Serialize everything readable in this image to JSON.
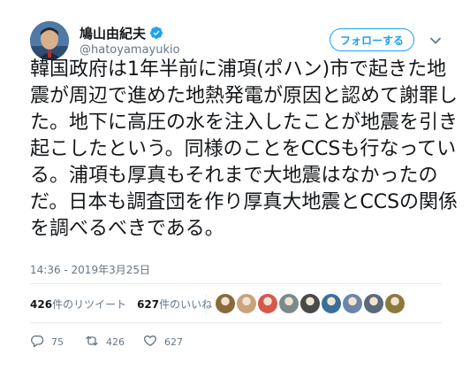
{
  "user": {
    "display_name": "鳩山由紀夫",
    "handle": "@hatoyamayukio",
    "verified": true
  },
  "follow_button": {
    "label": "フォローする"
  },
  "tweet": {
    "text": "韓国政府は1年半前に浦項(ポハン)市で起きた地震が周辺で進めた地熱発電が原因と認めて謝罪した。地下に高圧の水を注入したことが地震を引き起こしたという。同様のことをCCSも行なっている。浦項も厚真もそれまで大地震はなかったのだ。日本も調査団を作り厚真大地震とCCSの関係を調べるべきである。",
    "timestamp": "14:36 - 2019年3月25日"
  },
  "stats": {
    "retweets_count": "426",
    "retweets_label": "件のリツイート",
    "likes_count": "627",
    "likes_label": "件のいいね"
  },
  "likers": [
    {
      "icon": "liker-avatar-1",
      "color": "#8a6a3a"
    },
    {
      "icon": "liker-avatar-2",
      "color": "#c9a37a"
    },
    {
      "icon": "liker-avatar-3",
      "color": "#d65a4a"
    },
    {
      "icon": "liker-avatar-4",
      "color": "#7c8a8c"
    },
    {
      "icon": "liker-avatar-5",
      "color": "#4a4a4a"
    },
    {
      "icon": "liker-avatar-6",
      "color": "#3c6f9a"
    },
    {
      "icon": "liker-avatar-7",
      "color": "#6b86a8"
    },
    {
      "icon": "liker-avatar-8",
      "color": "#5a6a7a"
    },
    {
      "icon": "liker-avatar-9",
      "color": "#8c7a3a"
    }
  ],
  "actions": {
    "reply_count": "75",
    "retweet_count": "426",
    "like_count": "627"
  },
  "colors": {
    "accent": "#1da1f2",
    "text": "#14171a",
    "secondary": "#657786",
    "divider": "#e6ecf0"
  }
}
